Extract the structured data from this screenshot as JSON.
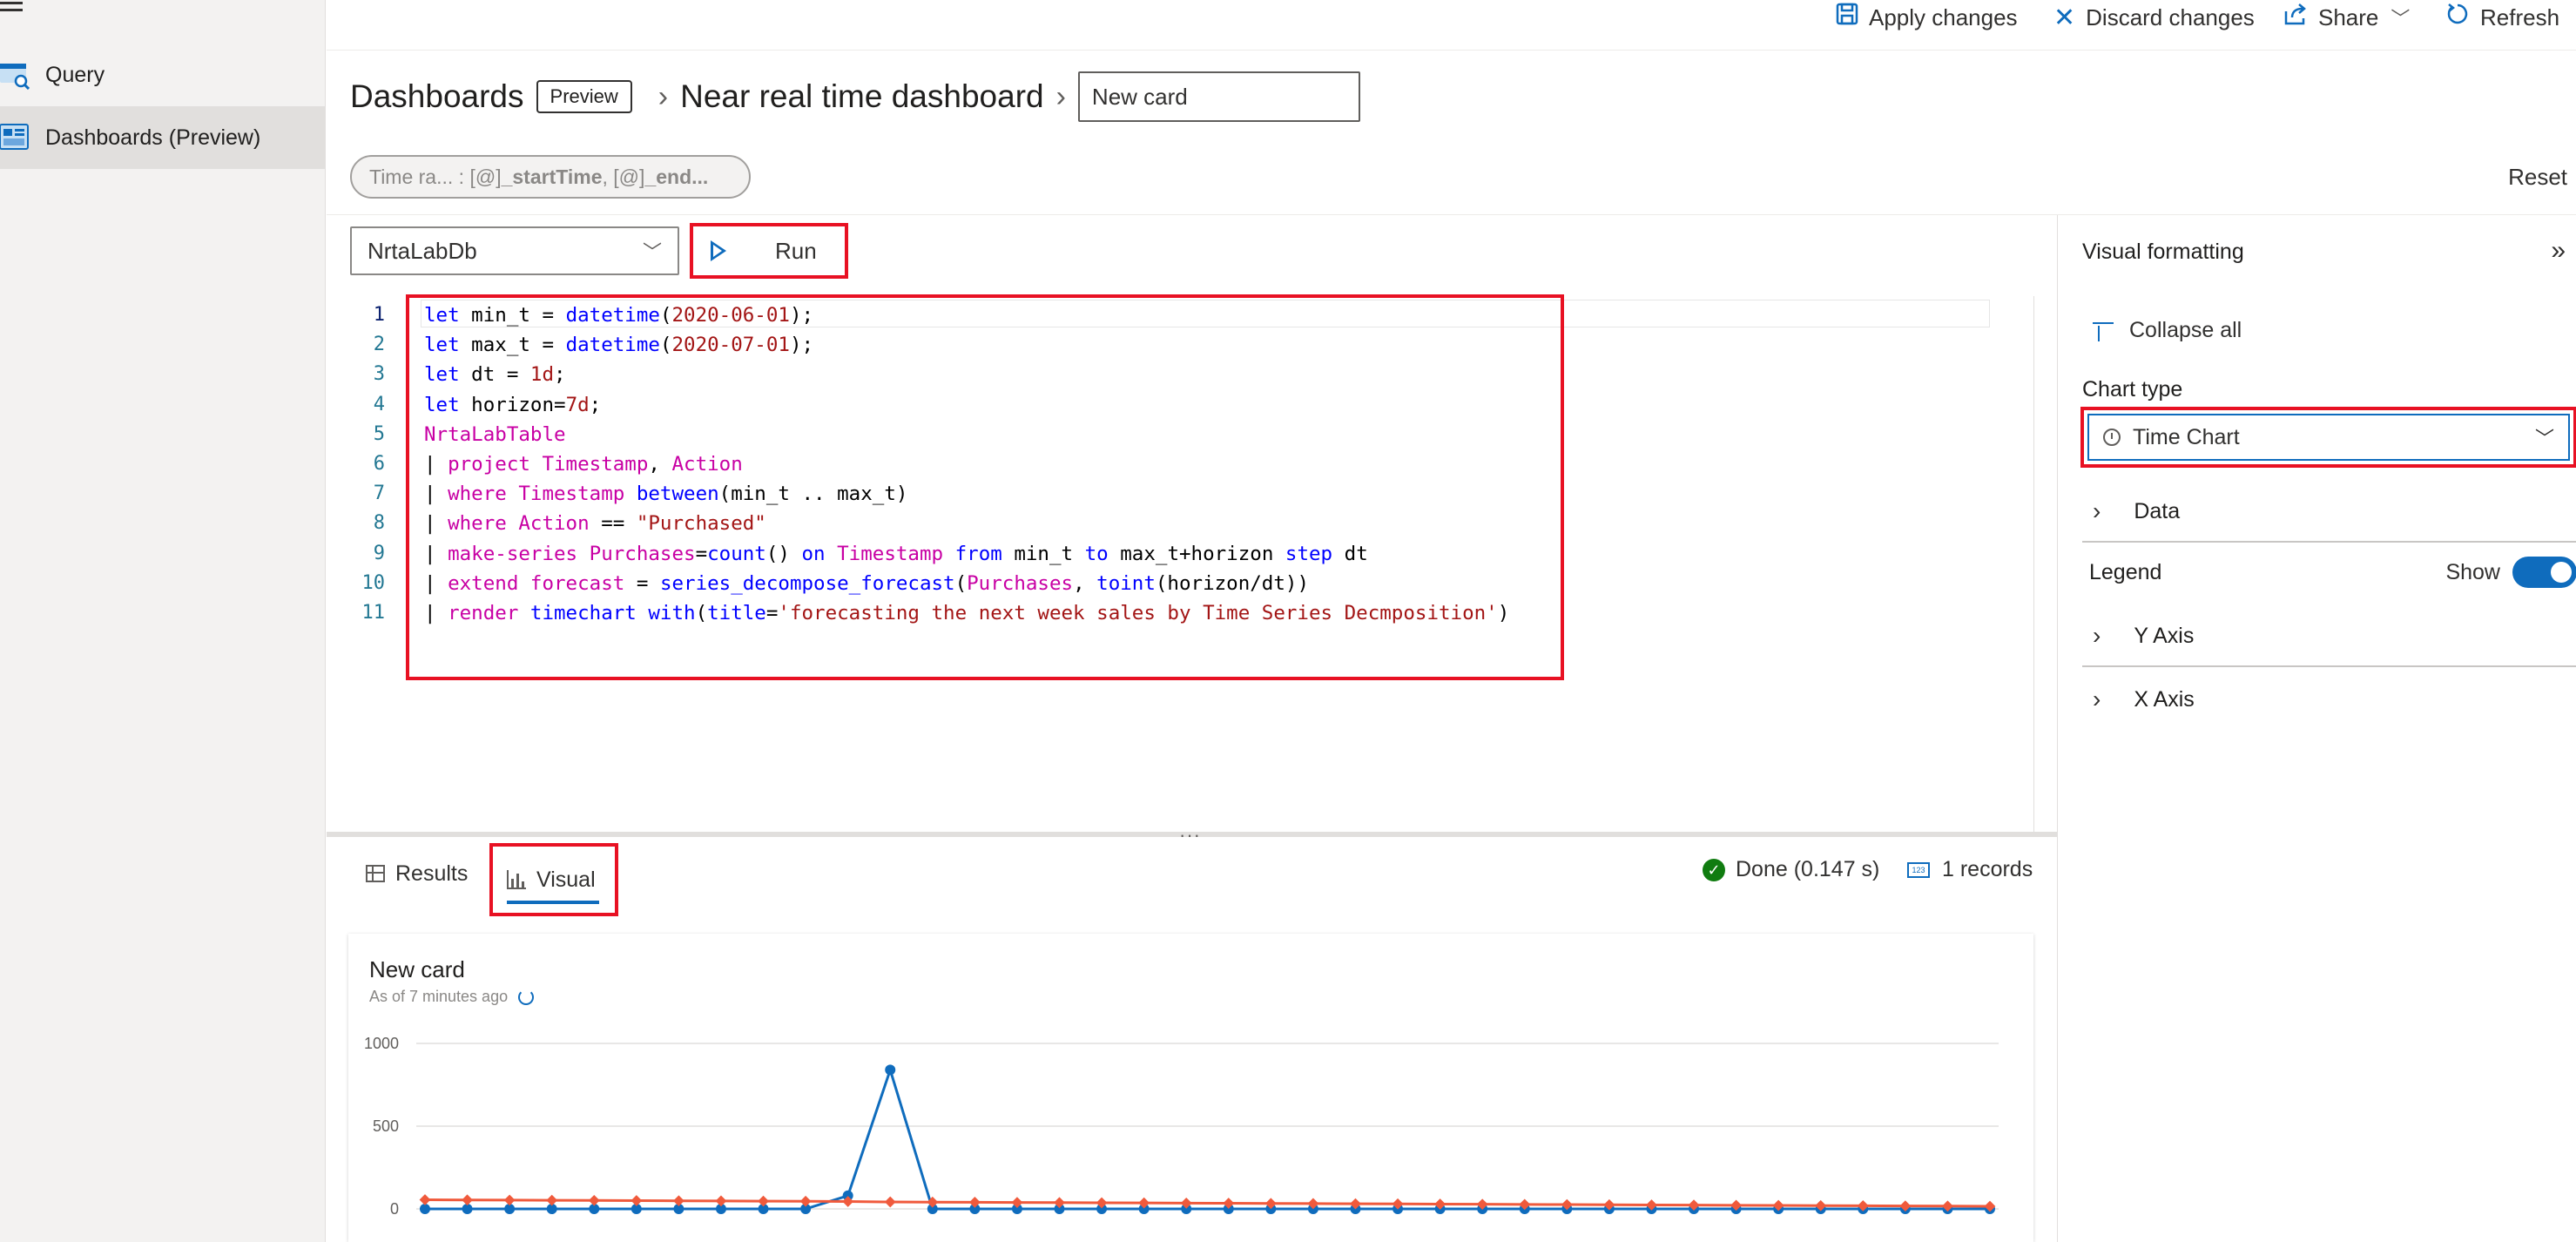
{
  "sidebar": {
    "items": [
      {
        "label": "Query",
        "icon": "query-icon"
      },
      {
        "label": "Dashboards (Preview)",
        "icon": "dashboard-icon",
        "active": true
      }
    ]
  },
  "toolbar": {
    "apply_label": "Apply changes",
    "discard_label": "Discard changes",
    "share_label": "Share",
    "refresh_label": "Refresh"
  },
  "breadcrumb": {
    "root": "Dashboards",
    "badge": "Preview",
    "dashboard": "Near real time dashboard",
    "card_name": "New card"
  },
  "time_range": {
    "label": "Time ra...",
    "sep": " : ",
    "p1": "[@]",
    "start": "_startTime",
    "comma": ", ",
    "p2": "[@]",
    "end": "_end..."
  },
  "reset_label": "Reset",
  "query": {
    "database": "NrtaLabDb",
    "run_label": "Run",
    "line_numbers": [
      "1",
      "2",
      "3",
      "4",
      "5",
      "6",
      "7",
      "8",
      "9",
      "10",
      "11"
    ]
  },
  "results": {
    "tab_results": "Results",
    "tab_visual": "Visual",
    "status": "Done (0.147 s)",
    "records": "1 records"
  },
  "card": {
    "title": "New card",
    "subtitle": "As of 7 minutes ago"
  },
  "format_panel": {
    "title": "Visual formatting",
    "collapse_label": "Collapse all",
    "chart_type_label": "Chart type",
    "chart_type_value": "Time Chart",
    "data_label": "Data",
    "legend_label": "Legend",
    "legend_toggle_label": "Show",
    "yaxis_label": "Y Axis",
    "xaxis_label": "X Axis"
  },
  "colors": {
    "accent": "#0f6cbd",
    "highlight": "#e81123",
    "purchases": "#0f6cbd",
    "forecast": "#f05a3c"
  },
  "chart_data": {
    "type": "line",
    "title": "",
    "yticks": [
      0,
      500,
      1000
    ],
    "ylim": [
      0,
      1000
    ],
    "grid": true,
    "series": [
      {
        "color": "#0f6cbd",
        "values": [
          0,
          0,
          0,
          0,
          0,
          0,
          0,
          0,
          0,
          0,
          80,
          840,
          0,
          0,
          0,
          0,
          0,
          0,
          0,
          0,
          0,
          0,
          0,
          0,
          0,
          0,
          0,
          0,
          0,
          0,
          0,
          0,
          0,
          0,
          0,
          0,
          0,
          0
        ]
      },
      {
        "color": "#f05a3c",
        "values": [
          55,
          54,
          53,
          52,
          51,
          50,
          49,
          48,
          47,
          46,
          45,
          42,
          41,
          40,
          39,
          38,
          37,
          36,
          35,
          34,
          33,
          32,
          31,
          30,
          29,
          28,
          27,
          26,
          25,
          24,
          23,
          22,
          21,
          20,
          19,
          18,
          17,
          16
        ]
      }
    ]
  }
}
